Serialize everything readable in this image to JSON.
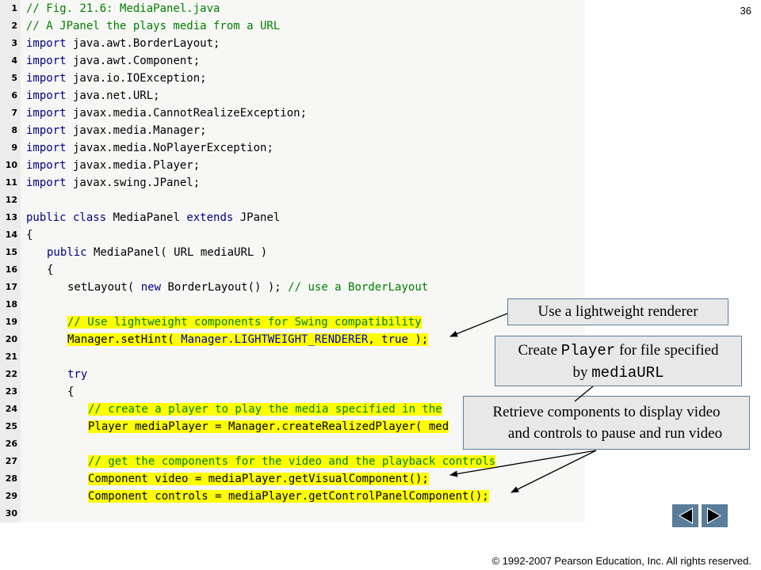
{
  "slide_number": "36",
  "copyright": "© 1992-2007 Pearson Education, Inc.  All rights reserved.",
  "code_lines": [
    {
      "n": "1",
      "indent": 0,
      "hl": false,
      "tokens": [
        {
          "t": "// Fig. 21.6: MediaPanel.java",
          "c": "c"
        }
      ]
    },
    {
      "n": "2",
      "indent": 0,
      "hl": false,
      "tokens": [
        {
          "t": "// A JPanel the plays media from a URL",
          "c": "c"
        }
      ]
    },
    {
      "n": "3",
      "indent": 0,
      "hl": false,
      "tokens": [
        {
          "t": "import",
          "c": "k"
        },
        {
          "t": " java.awt.BorderLayout;",
          "c": ""
        }
      ]
    },
    {
      "n": "4",
      "indent": 0,
      "hl": false,
      "tokens": [
        {
          "t": "import",
          "c": "k"
        },
        {
          "t": " java.awt.Component;",
          "c": ""
        }
      ]
    },
    {
      "n": "5",
      "indent": 0,
      "hl": false,
      "tokens": [
        {
          "t": "import",
          "c": "k"
        },
        {
          "t": " java.io.IOException;",
          "c": ""
        }
      ]
    },
    {
      "n": "6",
      "indent": 0,
      "hl": false,
      "tokens": [
        {
          "t": "import",
          "c": "k"
        },
        {
          "t": " java.net.URL;",
          "c": ""
        }
      ]
    },
    {
      "n": "7",
      "indent": 0,
      "hl": false,
      "tokens": [
        {
          "t": "import",
          "c": "k"
        },
        {
          "t": " javax.media.CannotRealizeException;",
          "c": ""
        }
      ]
    },
    {
      "n": "8",
      "indent": 0,
      "hl": false,
      "tokens": [
        {
          "t": "import",
          "c": "k"
        },
        {
          "t": " javax.media.Manager;",
          "c": ""
        }
      ]
    },
    {
      "n": "9",
      "indent": 0,
      "hl": false,
      "tokens": [
        {
          "t": "import",
          "c": "k"
        },
        {
          "t": " javax.media.NoPlayerException;",
          "c": ""
        }
      ]
    },
    {
      "n": "10",
      "indent": 0,
      "hl": false,
      "tokens": [
        {
          "t": "import",
          "c": "k"
        },
        {
          "t": " javax.media.Player;",
          "c": ""
        }
      ]
    },
    {
      "n": "11",
      "indent": 0,
      "hl": false,
      "tokens": [
        {
          "t": "import",
          "c": "k"
        },
        {
          "t": " javax.swing.JPanel;",
          "c": ""
        }
      ]
    },
    {
      "n": "12",
      "indent": 0,
      "hl": false,
      "tokens": []
    },
    {
      "n": "13",
      "indent": 0,
      "hl": false,
      "tokens": [
        {
          "t": "public class",
          "c": "k"
        },
        {
          "t": " MediaPanel ",
          "c": ""
        },
        {
          "t": "extends",
          "c": "k"
        },
        {
          "t": " JPanel",
          "c": ""
        }
      ]
    },
    {
      "n": "14",
      "indent": 0,
      "hl": false,
      "tokens": [
        {
          "t": "{",
          "c": ""
        }
      ]
    },
    {
      "n": "15",
      "indent": 1,
      "hl": false,
      "tokens": [
        {
          "t": "public",
          "c": "k"
        },
        {
          "t": " MediaPanel( URL mediaURL )",
          "c": ""
        }
      ]
    },
    {
      "n": "16",
      "indent": 1,
      "hl": false,
      "tokens": [
        {
          "t": "{",
          "c": ""
        }
      ]
    },
    {
      "n": "17",
      "indent": 2,
      "hl": false,
      "tokens": [
        {
          "t": "setLayout( ",
          "c": ""
        },
        {
          "t": "new",
          "c": "k"
        },
        {
          "t": " BorderLayout() ); ",
          "c": ""
        },
        {
          "t": "// use a BorderLayout",
          "c": "c"
        }
      ]
    },
    {
      "n": "18",
      "indent": 0,
      "hl": false,
      "tokens": []
    },
    {
      "n": "19",
      "indent": 2,
      "hl": true,
      "tokens": [
        {
          "t": "// Use lightweight components for Swing compatibility",
          "c": "c"
        }
      ]
    },
    {
      "n": "20",
      "indent": 2,
      "hl": true,
      "tokens": [
        {
          "t": "Manager.setHint( ",
          "c": ""
        },
        {
          "t": "Manager.LIGHTWEIGHT_RENDERER",
          "c": "s"
        },
        {
          "t": ", ",
          "c": ""
        },
        {
          "t": "true",
          "c": "k"
        },
        {
          "t": " );",
          "c": ""
        }
      ]
    },
    {
      "n": "21",
      "indent": 0,
      "hl": false,
      "tokens": []
    },
    {
      "n": "22",
      "indent": 2,
      "hl": false,
      "tokens": [
        {
          "t": "try",
          "c": "k"
        }
      ]
    },
    {
      "n": "23",
      "indent": 2,
      "hl": false,
      "tokens": [
        {
          "t": "{",
          "c": ""
        }
      ]
    },
    {
      "n": "24",
      "indent": 3,
      "hl": true,
      "tokens": [
        {
          "t": "// create a player to play the media specified in the",
          "c": "c"
        }
      ]
    },
    {
      "n": "25",
      "indent": 3,
      "hl": true,
      "tokens": [
        {
          "t": "Player mediaPlayer = Manager.createRealizedPlayer( med",
          "c": ""
        }
      ]
    },
    {
      "n": "26",
      "indent": 0,
      "hl": false,
      "tokens": []
    },
    {
      "n": "27",
      "indent": 3,
      "hl": true,
      "tokens": [
        {
          "t": "// get the components for the video and the playback controls",
          "c": "c"
        }
      ]
    },
    {
      "n": "28",
      "indent": 3,
      "hl": true,
      "tokens": [
        {
          "t": "Component video = mediaPlayer.getVisualComponent();",
          "c": ""
        }
      ]
    },
    {
      "n": "29",
      "indent": 3,
      "hl": true,
      "tokens": [
        {
          "t": "Component controls = mediaPlayer.getControlPanelComponent();",
          "c": ""
        }
      ]
    },
    {
      "n": "30",
      "indent": 0,
      "hl": false,
      "tokens": []
    }
  ],
  "callouts": {
    "lightweight": {
      "text": "Use a lightweight renderer"
    },
    "create_player": {
      "pre": "Create ",
      "mono1": "Player",
      "mid": " for file specified",
      "line2_pre": "by ",
      "mono2": "mediaURL"
    },
    "retrieve": {
      "line1": "Retrieve components to display video",
      "line2": "and controls to pause and run video"
    }
  },
  "nav": {
    "prev_icon": "triangle-left-icon",
    "next_icon": "triangle-right-icon",
    "button_color": "#5a7d9a"
  },
  "colors": {
    "highlight": "#ffff00",
    "comment": "#008000",
    "keyword": "#00008b",
    "constant": "#0000cc"
  }
}
